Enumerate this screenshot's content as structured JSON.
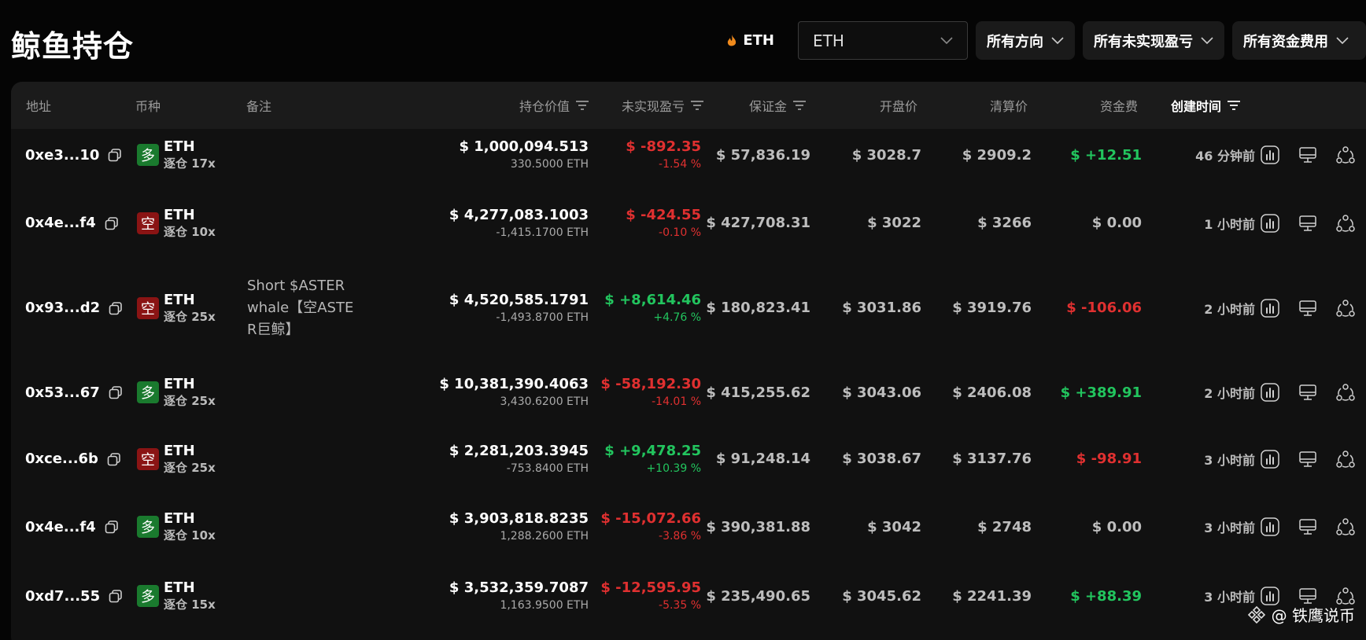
{
  "page": {
    "title": "鲸鱼持仓"
  },
  "filters": {
    "symbol_label": "ETH",
    "symbol_select": "ETH",
    "direction": "所有方向",
    "pnl": "所有未实现盈亏",
    "funding": "所有资金费用"
  },
  "table": {
    "headers": {
      "address": "地址",
      "coin": "币种",
      "note": "备注",
      "value": "持仓价值",
      "pnl": "未实现盈亏",
      "margin": "保证金",
      "entry": "开盘价",
      "liq": "清算价",
      "funding": "资金费",
      "created": "创建时间"
    },
    "rows": [
      {
        "address": "0xe3...10",
        "side": "多",
        "coin": "ETH",
        "leverage": "逐仓 17x",
        "note": "",
        "value": "$ 1,000,094.513",
        "size": "330.5000 ETH",
        "pnl": "$ -892.35",
        "pnl_pct": "-1.54 %",
        "margin": "$ 57,836.19",
        "entry": "$ 3028.7",
        "liq": "$ 2909.2",
        "funding": "$ +12.51",
        "created": "46 分钟前"
      },
      {
        "address": "0x4e...f4",
        "side": "空",
        "coin": "ETH",
        "leverage": "逐仓 10x",
        "note": "",
        "value": "$ 4,277,083.1003",
        "size": "-1,415.1700 ETH",
        "pnl": "$ -424.55",
        "pnl_pct": "-0.10 %",
        "margin": "$ 427,708.31",
        "entry": "$ 3022",
        "liq": "$ 3266",
        "funding": "$ 0.00",
        "created": "1 小时前"
      },
      {
        "address": "0x93...d2",
        "side": "空",
        "coin": "ETH",
        "leverage": "逐仓 25x",
        "note": "Short $ASTER whale【空ASTER巨鲸】",
        "value": "$ 4,520,585.1791",
        "size": "-1,493.8700 ETH",
        "pnl": "$ +8,614.46",
        "pnl_pct": "+4.76 %",
        "margin": "$ 180,823.41",
        "entry": "$ 3031.86",
        "liq": "$ 3919.76",
        "funding": "$ -106.06",
        "created": "2 小时前"
      },
      {
        "address": "0x53...67",
        "side": "多",
        "coin": "ETH",
        "leverage": "逐仓 25x",
        "note": "",
        "value": "$ 10,381,390.4063",
        "size": "3,430.6200 ETH",
        "pnl": "$ -58,192.30",
        "pnl_pct": "-14.01 %",
        "margin": "$ 415,255.62",
        "entry": "$ 3043.06",
        "liq": "$ 2406.08",
        "funding": "$ +389.91",
        "created": "2 小时前"
      },
      {
        "address": "0xce...6b",
        "side": "空",
        "coin": "ETH",
        "leverage": "逐仓 25x",
        "note": "",
        "value": "$ 2,281,203.3945",
        "size": "-753.8400 ETH",
        "pnl": "$ +9,478.25",
        "pnl_pct": "+10.39 %",
        "margin": "$ 91,248.14",
        "entry": "$ 3038.67",
        "liq": "$ 3137.76",
        "funding": "$ -98.91",
        "created": "3 小时前"
      },
      {
        "address": "0x4e...f4",
        "side": "多",
        "coin": "ETH",
        "leverage": "逐仓 10x",
        "note": "",
        "value": "$ 3,903,818.8235",
        "size": "1,288.2600 ETH",
        "pnl": "$ -15,072.66",
        "pnl_pct": "-3.86 %",
        "margin": "$ 390,381.88",
        "entry": "$ 3042",
        "liq": "$ 2748",
        "funding": "$ 0.00",
        "created": "3 小时前"
      },
      {
        "address": "0xd7...55",
        "side": "多",
        "coin": "ETH",
        "leverage": "逐仓 15x",
        "note": "",
        "value": "$ 3,532,359.7087",
        "size": "1,163.9500 ETH",
        "pnl": "$ -12,595.95",
        "pnl_pct": "-5.35 %",
        "margin": "$ 235,490.65",
        "entry": "$ 3045.62",
        "liq": "$ 2241.39",
        "funding": "$ +88.39",
        "created": "3 小时前"
      }
    ]
  },
  "watermark": {
    "text": "@ 铁鹰说币"
  },
  "colors": {
    "long": "#1a7a2e",
    "short": "#8a1414",
    "positive": "#22c55e",
    "negative": "#e03030"
  },
  "icons": [
    "fire-icon",
    "chevron-down-icon",
    "sort-icon",
    "copy-icon",
    "chart-icon",
    "monitor-icon",
    "share-icon",
    "binance-logo-icon"
  ]
}
